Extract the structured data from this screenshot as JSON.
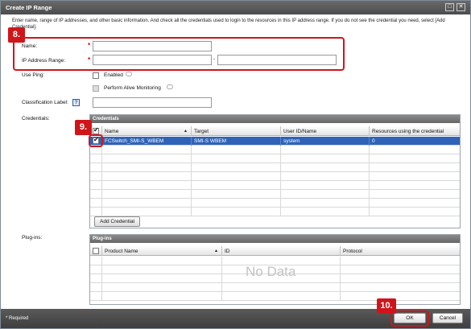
{
  "window": {
    "title": "Create IP Range",
    "restore_glyph": "□",
    "close_glyph": "✕"
  },
  "intro_text": "Enter name, range of IP addresses, and other basic information. And check all the credentials used to login to the resources in this IP address range. If you do not see the credential you need, select [Add Credential].",
  "form": {
    "name_label": "Name:",
    "ip_range_label": "IP Address Range:",
    "required_mark": "*",
    "range_separator": "-",
    "use_ping_label": "Use Ping:",
    "enabled_label": "Enabled",
    "alive_monitoring_label": "Perform Alive Monitoring",
    "classification_label": "Classification Label:",
    "help_glyph": "?",
    "credentials_label": "Credentials:",
    "plugins_label": "Plug-ins:"
  },
  "credentials_table": {
    "title": "Credentials",
    "columns": [
      "Name",
      "Target",
      "User ID/Name",
      "Resources using the credential"
    ],
    "rows": [
      {
        "name": "FCSwitch_SMI-S_WBEM",
        "target": "SMI-S WBEM",
        "user": "system",
        "resources": "0",
        "checked": true
      }
    ],
    "add_button": "Add Credential"
  },
  "plugins_table": {
    "title": "Plug-ins",
    "columns": [
      "Product Name",
      "ID",
      "Protocol"
    ],
    "empty_text": "No Data"
  },
  "footer": {
    "required_note": "* Required",
    "ok_button": "OK",
    "cancel_button": "Cancel"
  },
  "annotations": {
    "step_8": "8.",
    "step_9": "9.",
    "step_10": "10."
  },
  "colors": {
    "highlight_red": "#d0151a",
    "selection_blue": "#2e63b8",
    "required_red": "#dd0000"
  },
  "sort_glyph": "▲"
}
